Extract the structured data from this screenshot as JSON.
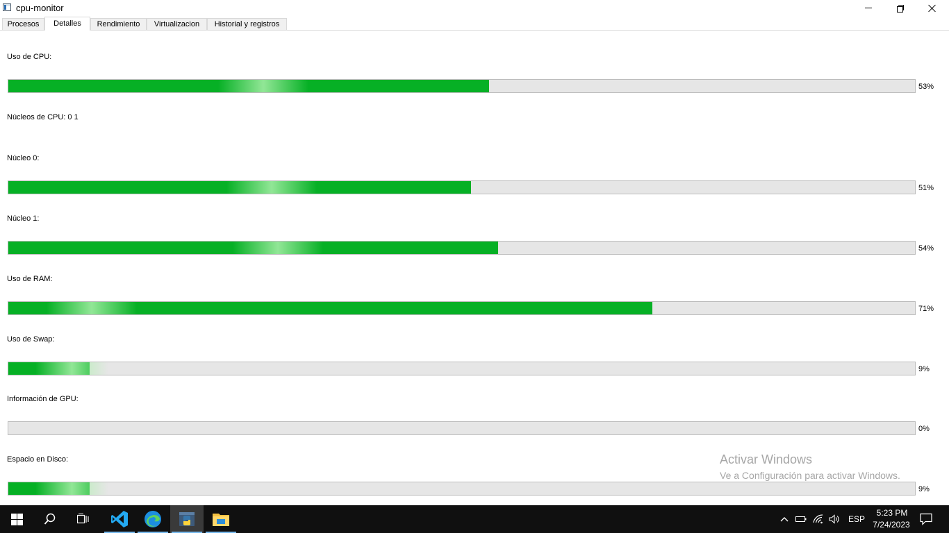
{
  "window": {
    "title": "cpu-monitor"
  },
  "tabs": [
    {
      "label": "Procesos",
      "active": false
    },
    {
      "label": "Detalles",
      "active": true
    },
    {
      "label": "Rendimiento",
      "active": false
    },
    {
      "label": "Virtualizacion",
      "active": false
    },
    {
      "label": "Historial y registros",
      "active": false
    }
  ],
  "details": {
    "cpu_label": "Uso de CPU:",
    "cpu_percent_text": "53%",
    "cpu_value": 0.53,
    "cores_text": "Núcleos de CPU: 0 1",
    "core0_label": "Núcleo 0:",
    "core0_percent_text": "51%",
    "core0_value": 0.51,
    "core1_label": "Núcleo 1:",
    "core1_percent_text": "54%",
    "core1_value": 0.54,
    "ram_label": "Uso de RAM:",
    "ram_percent_text": "71%",
    "ram_value": 0.71,
    "swap_label": "Uso de Swap:",
    "swap_percent_text": "9%",
    "swap_value": 0.09,
    "gpu_label": "Información de GPU:",
    "gpu_percent_text": "0%",
    "gpu_value": 0.0,
    "disk_label": "Espacio en Disco:",
    "disk_percent_text": "9%",
    "disk_value": 0.09
  },
  "colors": {
    "bar_fill": "#06b025",
    "bar_track": "#e6e6e6",
    "taskbar": "#101010"
  },
  "watermark": {
    "line1": "Activar Windows",
    "line2": "Ve a Configuración para activar Windows."
  },
  "taskbar": {
    "icons": [
      "windows-start-icon",
      "search-icon",
      "task-view-icon",
      "vscode-icon",
      "edge-icon",
      "python-icon",
      "file-explorer-icon"
    ],
    "language": "ESP",
    "time": "5:23 PM",
    "date": "7/24/2023"
  }
}
